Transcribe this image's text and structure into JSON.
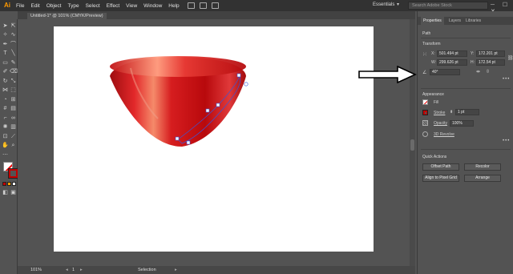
{
  "app": {
    "logo": "Ai"
  },
  "menu": [
    "File",
    "Edit",
    "Object",
    "Type",
    "Select",
    "Effect",
    "View",
    "Window",
    "Help"
  ],
  "workspace_switcher": {
    "label": "Essentials",
    "chevron": "▾"
  },
  "stock_search": {
    "placeholder": "Search Adobe Stock"
  },
  "window_controls": "─ ☐ ✕",
  "document": {
    "tab_title": "Untitled-1* @ 101% (CMYK/Preview)"
  },
  "statusbar": {
    "zoom": "101%",
    "artboard": "1",
    "tool": "Selection"
  },
  "panel": {
    "tabs": [
      "Properties",
      "Layers",
      "Libraries"
    ],
    "object_type": "Path",
    "transform": {
      "title": "Transform",
      "x_label": "X:",
      "x": "501.494 pt",
      "y_label": "Y:",
      "y": "172.201 pt",
      "w_label": "W:",
      "w": "299.626 pt",
      "h_label": "H:",
      "h": "172.54 pt",
      "angle": "40°"
    },
    "appearance": {
      "title": "Appearance",
      "fill_label": "Fill",
      "stroke_label": "Stroke",
      "stroke_weight": "1 pt",
      "opacity_label": "Opacity",
      "opacity": "100%",
      "revolve_label": "3D Revolve"
    },
    "quick_actions": {
      "title": "Quick Actions",
      "offset_path": "Offset Path",
      "recolor": "Recolor",
      "align_pixel": "Align to Pixel Grid",
      "arrange": "Arrange"
    }
  },
  "colors": {
    "accent_red": "#c00000",
    "panel_bg": "#535353",
    "menu_bg": "#323232"
  }
}
